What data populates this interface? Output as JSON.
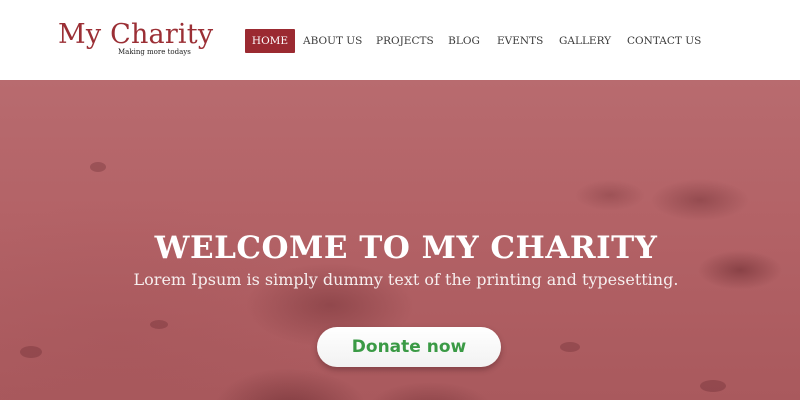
{
  "brand": {
    "name": "My Charity",
    "tagline": "Making more todays",
    "color": "#9b2f35"
  },
  "nav": {
    "items": [
      {
        "label": "HOME",
        "active": true
      },
      {
        "label": "ABOUT US",
        "active": false
      },
      {
        "label": "PROJECTS",
        "active": false
      },
      {
        "label": "BLOG",
        "active": false
      },
      {
        "label": "EVENTS",
        "active": false
      },
      {
        "label": "GALLERY",
        "active": false
      },
      {
        "label": "CONTACT US",
        "active": false
      }
    ],
    "active_color": "#9b2a31"
  },
  "hero": {
    "title": "WELCOME TO MY CHARITY",
    "subtitle": "Lorem Ipsum is simply dummy text of the printing and typesetting.",
    "cta_label": "Donate now",
    "cta_text_color": "#3a9a45",
    "overlay_color": "#b36266"
  }
}
